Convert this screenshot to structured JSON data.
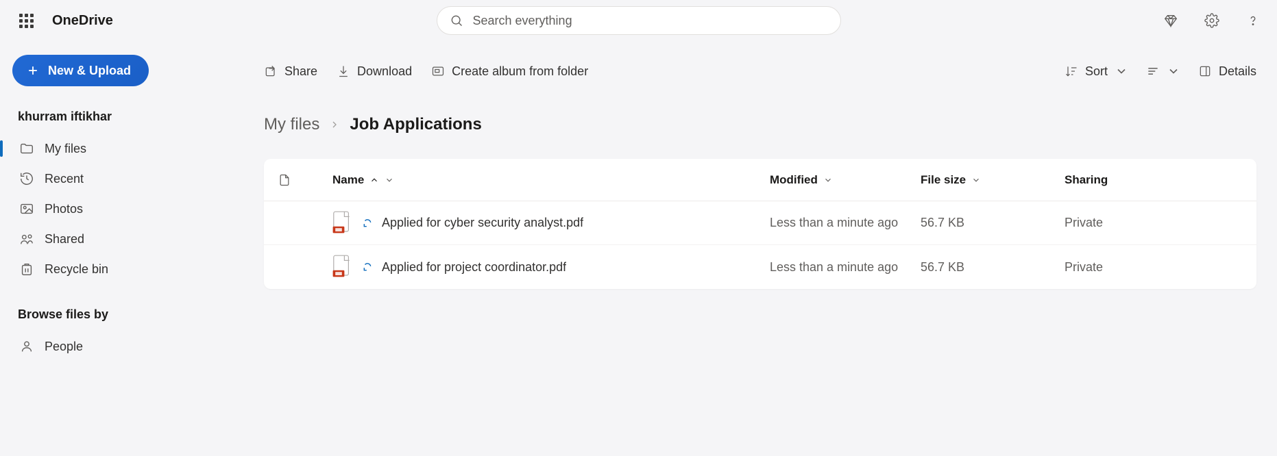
{
  "header": {
    "brand": "OneDrive",
    "search_placeholder": "Search everything"
  },
  "sidebar": {
    "new_label": "New & Upload",
    "user": "khurram iftikhar",
    "items": [
      {
        "label": "My files",
        "active": true
      },
      {
        "label": "Recent"
      },
      {
        "label": "Photos"
      },
      {
        "label": "Shared"
      },
      {
        "label": "Recycle bin"
      }
    ],
    "browse_heading": "Browse files by",
    "browse_items": [
      {
        "label": "People"
      }
    ]
  },
  "commands": {
    "share": "Share",
    "download": "Download",
    "create_album": "Create album from folder",
    "sort": "Sort",
    "details": "Details"
  },
  "breadcrumb": {
    "parent": "My files",
    "current": "Job Applications"
  },
  "columns": {
    "name": "Name",
    "modified": "Modified",
    "filesize": "File size",
    "sharing": "Sharing"
  },
  "files": [
    {
      "name": "Applied for cyber security analyst.pdf",
      "modified": "Less than a minute ago",
      "size": "56.7 KB",
      "sharing": "Private"
    },
    {
      "name": "Applied for project coordinator.pdf",
      "modified": "Less than a minute ago",
      "size": "56.7 KB",
      "sharing": "Private"
    }
  ]
}
